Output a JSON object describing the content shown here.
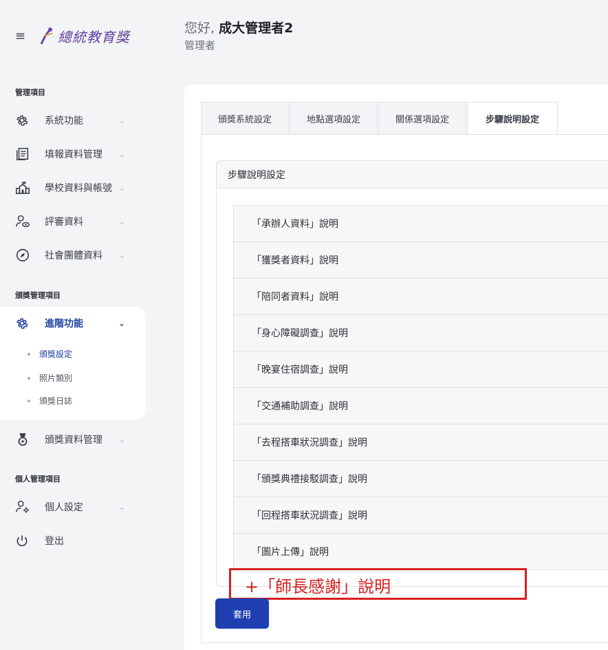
{
  "header": {
    "greeting_prefix": "您好, ",
    "user_name": "成大管理者2",
    "role": "管理者"
  },
  "brand": {
    "logo_text": "總統教育獎",
    "menu_icon": "hamburger-icon"
  },
  "sidebar": {
    "section_admin": "管理項目",
    "section_award": "頒獎管理項目",
    "section_personal": "個人管理項目",
    "items": {
      "system": "系統功能",
      "report_data": "填報資料管理",
      "school": "學校資料與帳號",
      "review": "評審資料",
      "org": "社會團體資料",
      "advanced": "進階功能",
      "award_data": "頒獎資料管理",
      "personal_settings": "個人設定",
      "logout": "登出"
    },
    "sub_items": [
      "頒獎設定",
      "照片類別",
      "頒獎日誌"
    ],
    "accent_color": "#1f3f9e"
  },
  "tabs": [
    "頒獎系統設定",
    "地點選項設定",
    "關係選項設定",
    "步驟說明設定"
  ],
  "panel": {
    "title": "步驟說明設定",
    "items": [
      "「承辦人資料」說明",
      "「獲獎者資料」說明",
      "「陪同者資料」說明",
      "「身心障礙調查」說明",
      "「晚宴住宿調查」說明",
      "「交通補助調查」說明",
      "「去程搭車狀況調查」說明",
      "「頒獎典禮接駁調查」說明",
      "「回程搭車狀況調查」說明",
      "「圖片上傳」說明"
    ]
  },
  "annotation": {
    "text": "+「師長感謝」說明",
    "color": "#d81f1f"
  },
  "actions": {
    "apply_label": "套用",
    "apply_color": "#1f3fb0"
  }
}
